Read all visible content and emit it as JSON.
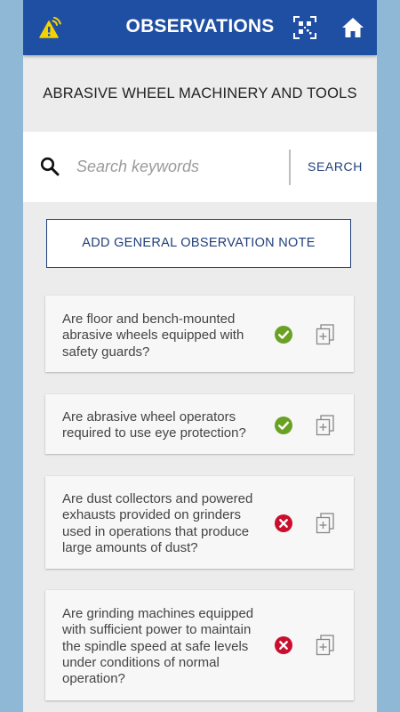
{
  "app": {
    "title": "OBSERVATIONS",
    "icons": [
      "alert-signal-icon",
      "qr-scan-icon",
      "home-icon"
    ],
    "accent_color": "#1f4fa3",
    "alert_color": "#f5d300"
  },
  "section": {
    "title": "ABRASIVE WHEEL MACHINERY AND TOOLS"
  },
  "search": {
    "placeholder": "Search keywords",
    "value": "",
    "button_label": "SEARCH"
  },
  "add_note": {
    "label": "ADD GENERAL OBSERVATION NOTE"
  },
  "observations": [
    {
      "question": "Are floor and bench-mounted abrasive wheels equipped with safety guards?",
      "status": "yes"
    },
    {
      "question": "Are abrasive wheel operators required to use eye protection?",
      "status": "yes"
    },
    {
      "question": "Are dust collectors and powered exhausts provided on grinders used in operations that produce large amounts of dust?",
      "status": "no"
    },
    {
      "question": "Are grinding machines equipped with sufficient power to maintain the spindle speed at safe levels under conditions of normal operation?",
      "status": "no"
    }
  ],
  "status_colors": {
    "yes": "#6aa123",
    "no": "#c8102e"
  }
}
